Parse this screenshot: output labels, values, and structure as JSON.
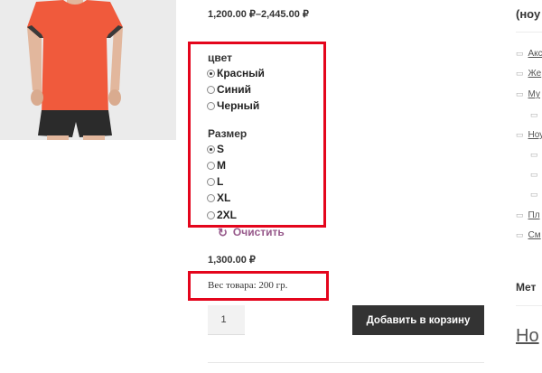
{
  "product": {
    "price_range": "1,200.00 ₽–2,445.00 ₽",
    "variation_price": "1,300.00 ₽",
    "weight": "Вес товара: 200 гр."
  },
  "attributes": {
    "color": {
      "label": "цвет",
      "options": [
        "Красный",
        "Синий",
        "Черный"
      ],
      "selected": "Красный"
    },
    "size": {
      "label": "Размер",
      "options": [
        "S",
        "M",
        "L",
        "XL",
        "2XL"
      ],
      "selected": "S"
    }
  },
  "reset_label": "Очистить",
  "cart": {
    "quantity": "1",
    "add_to_cart_label": "Добавить в корзину"
  },
  "sidebar": {
    "categories_title": "(ноу",
    "categories": [
      {
        "label": "Акс",
        "level": 0
      },
      {
        "label": "Же",
        "level": 0
      },
      {
        "label": "Му",
        "level": 0
      },
      {
        "label": "",
        "level": 1
      },
      {
        "label": "Ноу",
        "level": 0
      },
      {
        "label": "",
        "level": 1
      },
      {
        "label": "",
        "level": 1
      },
      {
        "label": "",
        "level": 1
      },
      {
        "label": "Пл",
        "level": 0
      },
      {
        "label": "См",
        "level": 0
      }
    ],
    "meta_title": "Мет",
    "news_title": "Но"
  },
  "icons": {
    "reset": "refresh-icon",
    "category": "folder-icon"
  },
  "colors": {
    "accent": "#96588a",
    "button": "#333333",
    "highlight_annotation": "#e4051c",
    "shirt": "#f05a3c"
  }
}
